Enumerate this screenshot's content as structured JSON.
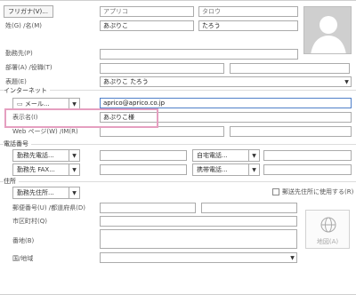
{
  "name": {
    "furigana_button": "フリガナ(V)...",
    "reading_last": "アプリコ",
    "reading_first": "タロウ",
    "name_label": "姓(G) /名(M)",
    "last": "あぷりこ",
    "first": "たろう"
  },
  "company": {
    "label": "勤務先(P)",
    "value": ""
  },
  "department": {
    "label": "部署(A) /役職(T)"
  },
  "display_as": {
    "label": "表題(E)",
    "value": "あぷりこ たろう"
  },
  "internet": {
    "section": "インターネット",
    "email_button": "メール...",
    "email": "aprico@aprico.co.jp",
    "display_name_label": "表示名(I)",
    "display_name": "あぷりこ様",
    "web_label": "Web ページ(W) /IM(R)"
  },
  "phone": {
    "section": "電話番号",
    "work_phone": "勤務先電話...",
    "home_phone": "自宅電話...",
    "work_fax": "勤務先 FAX...",
    "mobile": "携帯電話..."
  },
  "address": {
    "section": "住所",
    "type_button": "勤務先住所...",
    "mailing_checkbox": "郵送先住所に使用する(R)",
    "postal_label": "郵便番号(U) /都道府県(D)",
    "city_label": "市区町村(Q)",
    "street_label": "番地(B)",
    "country_label": "国/地域",
    "map_label": "地図(A)"
  },
  "colors": {
    "highlight": "#e59fc0",
    "focus": "#4f7fc8"
  }
}
